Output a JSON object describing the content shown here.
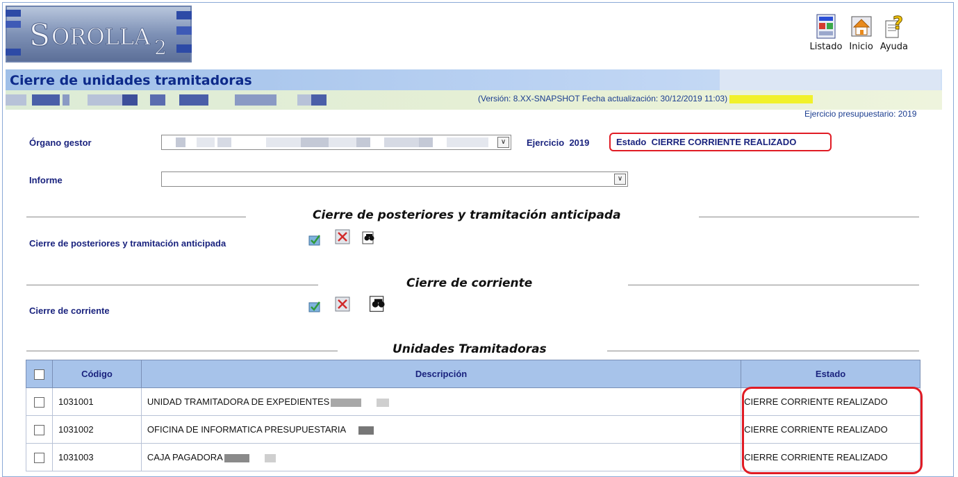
{
  "header": {
    "logo_text": "SOROLLA2",
    "nav": [
      {
        "label": "Listado",
        "icon": "report-icon"
      },
      {
        "label": "Inicio",
        "icon": "home-icon"
      },
      {
        "label": "Ayuda",
        "icon": "help-icon"
      }
    ]
  },
  "page": {
    "title": "Cierre de unidades tramitadoras",
    "version_text": "(Versión: 8.XX-SNAPSHOT Fecha actualización: 30/12/2019 11:03)",
    "ejercicio_presupuestario": "Ejercicio presupuestario: 2019"
  },
  "form": {
    "organo_label": "Órgano gestor",
    "ejercicio_label": "Ejercicio",
    "ejercicio_value": "2019",
    "estado_label": "Estado",
    "estado_value": "CIERRE CORRIENTE REALIZADO",
    "informe_label": "Informe",
    "informe_value": ""
  },
  "sections": {
    "posteriores_title": "Cierre de posteriores y tramitación anticipada",
    "posteriores_label": "Cierre de posteriores y tramitación anticipada",
    "corriente_title": "Cierre de corriente",
    "corriente_label": "Cierre de corriente",
    "unidades_title": "Unidades Tramitadoras"
  },
  "table": {
    "headers": {
      "codigo": "Código",
      "descripcion": "Descripción",
      "estado": "Estado"
    },
    "rows": [
      {
        "codigo": "1031001",
        "descripcion": "UNIDAD TRAMITADORA DE EXPEDIENTES",
        "estado": "CIERRE CORRIENTE REALIZADO"
      },
      {
        "codigo": "1031002",
        "descripcion": "OFICINA DE INFORMATICA PRESUPUESTARIA",
        "estado": "CIERRE CORRIENTE REALIZADO"
      },
      {
        "codigo": "1031003",
        "descripcion": "CAJA PAGADORA",
        "estado": "CIERRE CORRIENTE REALIZADO"
      }
    ]
  },
  "colors": {
    "title_bar": "#9fbfe8",
    "info_bar": "#dcebd6",
    "table_header": "#a7c3ea",
    "highlight_red": "#e01b24",
    "label_blue": "#1a237e"
  }
}
